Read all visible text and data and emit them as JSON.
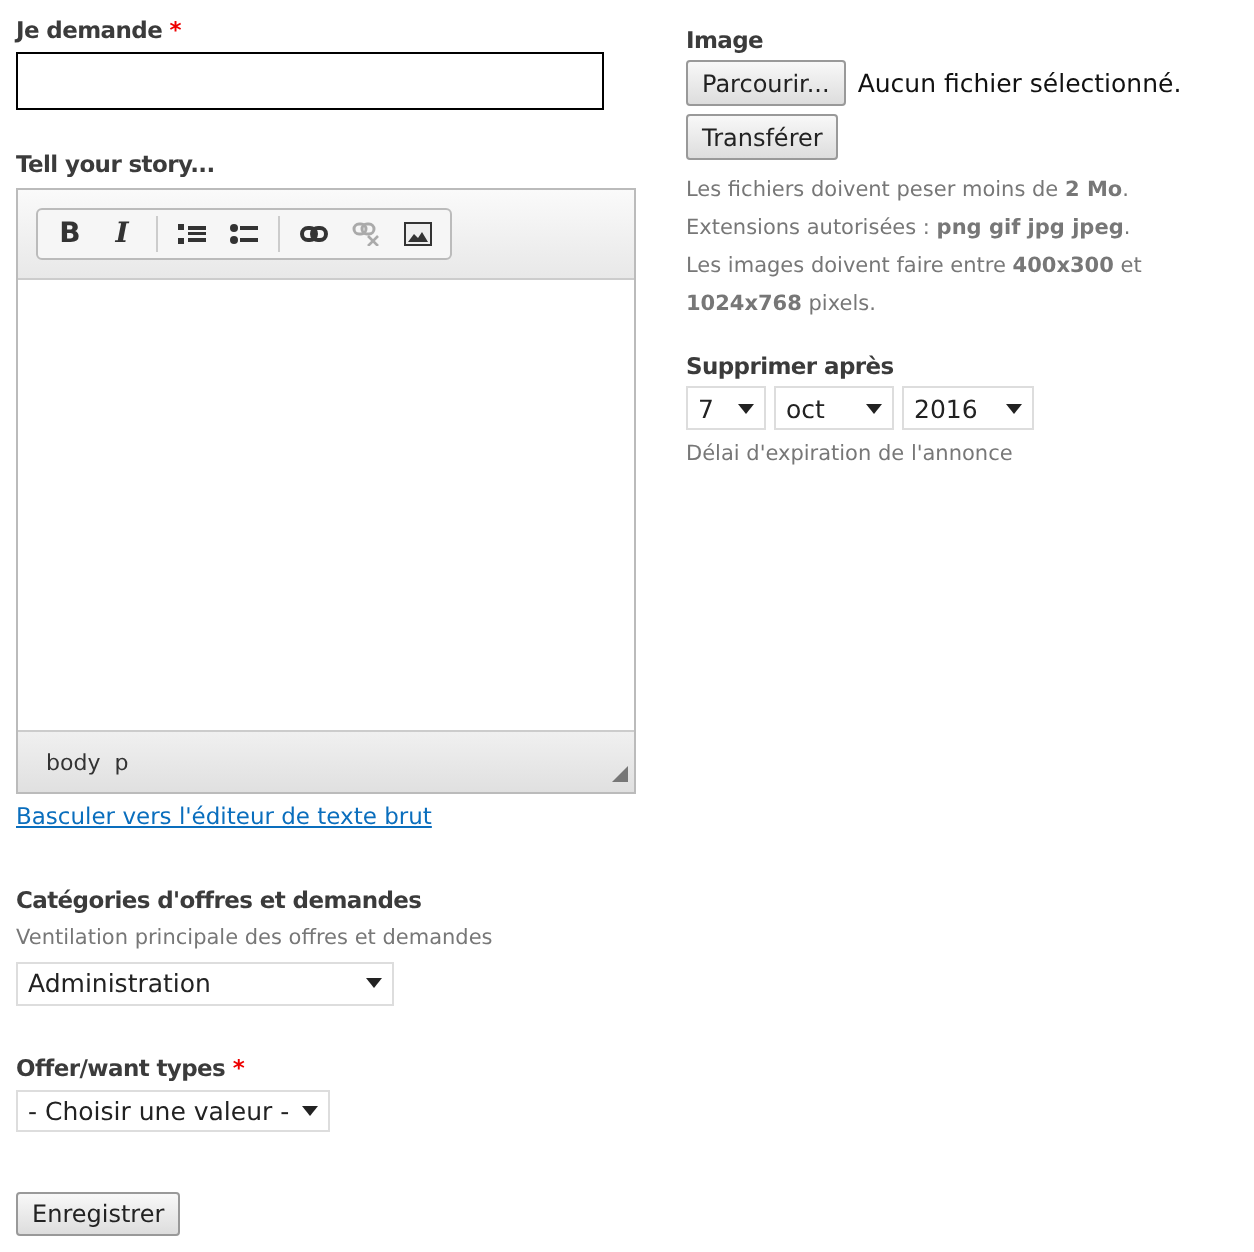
{
  "title_field": {
    "label": "Je demande",
    "required": true,
    "required_mark": "*"
  },
  "body_field": {
    "label": "Tell your story...",
    "toolbar": [
      {
        "kind": "bold",
        "label": "B",
        "disabled": false
      },
      {
        "kind": "italic",
        "label": "I",
        "disabled": false
      },
      {
        "kind": "numbered-list",
        "disabled": false
      },
      {
        "kind": "bulleted-list",
        "disabled": false
      },
      {
        "kind": "link",
        "disabled": false
      },
      {
        "kind": "unlink",
        "disabled": true
      },
      {
        "kind": "image",
        "disabled": false
      }
    ],
    "path": [
      "body",
      "p"
    ],
    "switch_link": "Basculer vers l'éditeur de texte brut"
  },
  "categories": {
    "label": "Catégories d'offres et demandes",
    "description": "Ventilation principale des offres et demandes",
    "value": "Administration"
  },
  "types": {
    "label": "Offer/want types",
    "required": true,
    "required_mark": "*",
    "value": "- Choisir une valeur -"
  },
  "submit": "Enregistrer",
  "image": {
    "label": "Image",
    "browse": "Parcourir...",
    "no_file": "Aucun fichier sélectionné.",
    "upload": "Transférer",
    "help": [
      "Les fichiers doivent peser moins de **2 Mo**.",
      "Extensions autorisées : **png gif jpg jpeg**.",
      "Les images doivent faire entre **400x300** et **1024x768** pixels."
    ]
  },
  "expiry": {
    "label": "Supprimer après",
    "day": "7",
    "month": "oct",
    "year": "2016",
    "description": "Délai d'expiration de l'annonce"
  }
}
